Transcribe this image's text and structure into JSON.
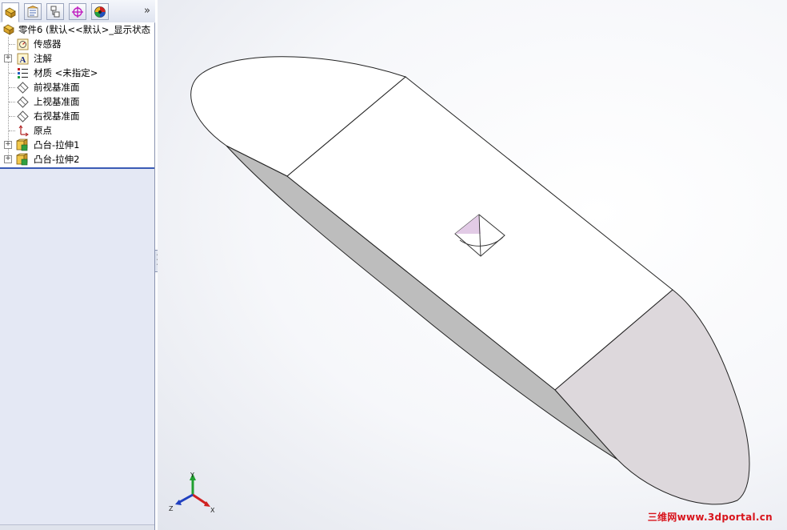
{
  "panel": {
    "tabs": [
      {
        "icon": "feature-manager-icon",
        "active": true
      },
      {
        "icon": "property-manager-icon",
        "active": false
      },
      {
        "icon": "configuration-manager-icon",
        "active": false
      },
      {
        "icon": "dimxpert-icon",
        "active": false
      },
      {
        "icon": "display-manager-icon",
        "active": false
      }
    ],
    "expand_glyph": "»"
  },
  "tree": {
    "root": {
      "label": "零件6  (默认<<默认>_显示状态",
      "icon": "part-icon"
    },
    "items": [
      {
        "label": "传感器",
        "icon": "sensor-icon",
        "expandable": false
      },
      {
        "label": "注解",
        "icon": "annotation-icon",
        "expandable": true
      },
      {
        "label": "材质 <未指定>",
        "icon": "material-icon",
        "expandable": false
      },
      {
        "label": "前视基准面",
        "icon": "plane-icon",
        "expandable": false
      },
      {
        "label": "上视基准面",
        "icon": "plane-icon",
        "expandable": false
      },
      {
        "label": "右视基准面",
        "icon": "plane-icon",
        "expandable": false
      },
      {
        "label": "原点",
        "icon": "origin-icon",
        "expandable": false
      },
      {
        "label": "凸台-拉伸1",
        "icon": "extrude-icon",
        "expandable": true
      },
      {
        "label": "凸台-拉伸2",
        "icon": "extrude-icon",
        "expandable": true
      }
    ]
  },
  "triad": {
    "x": "X",
    "y": "Y",
    "z": "Z"
  },
  "watermark": "三维网www.3dportal.cn",
  "colors": {
    "accent": "#3a5bb5",
    "model_face": "#ffffff",
    "model_side": "#c8c8c8",
    "model_cap": "#ddd8dc"
  }
}
